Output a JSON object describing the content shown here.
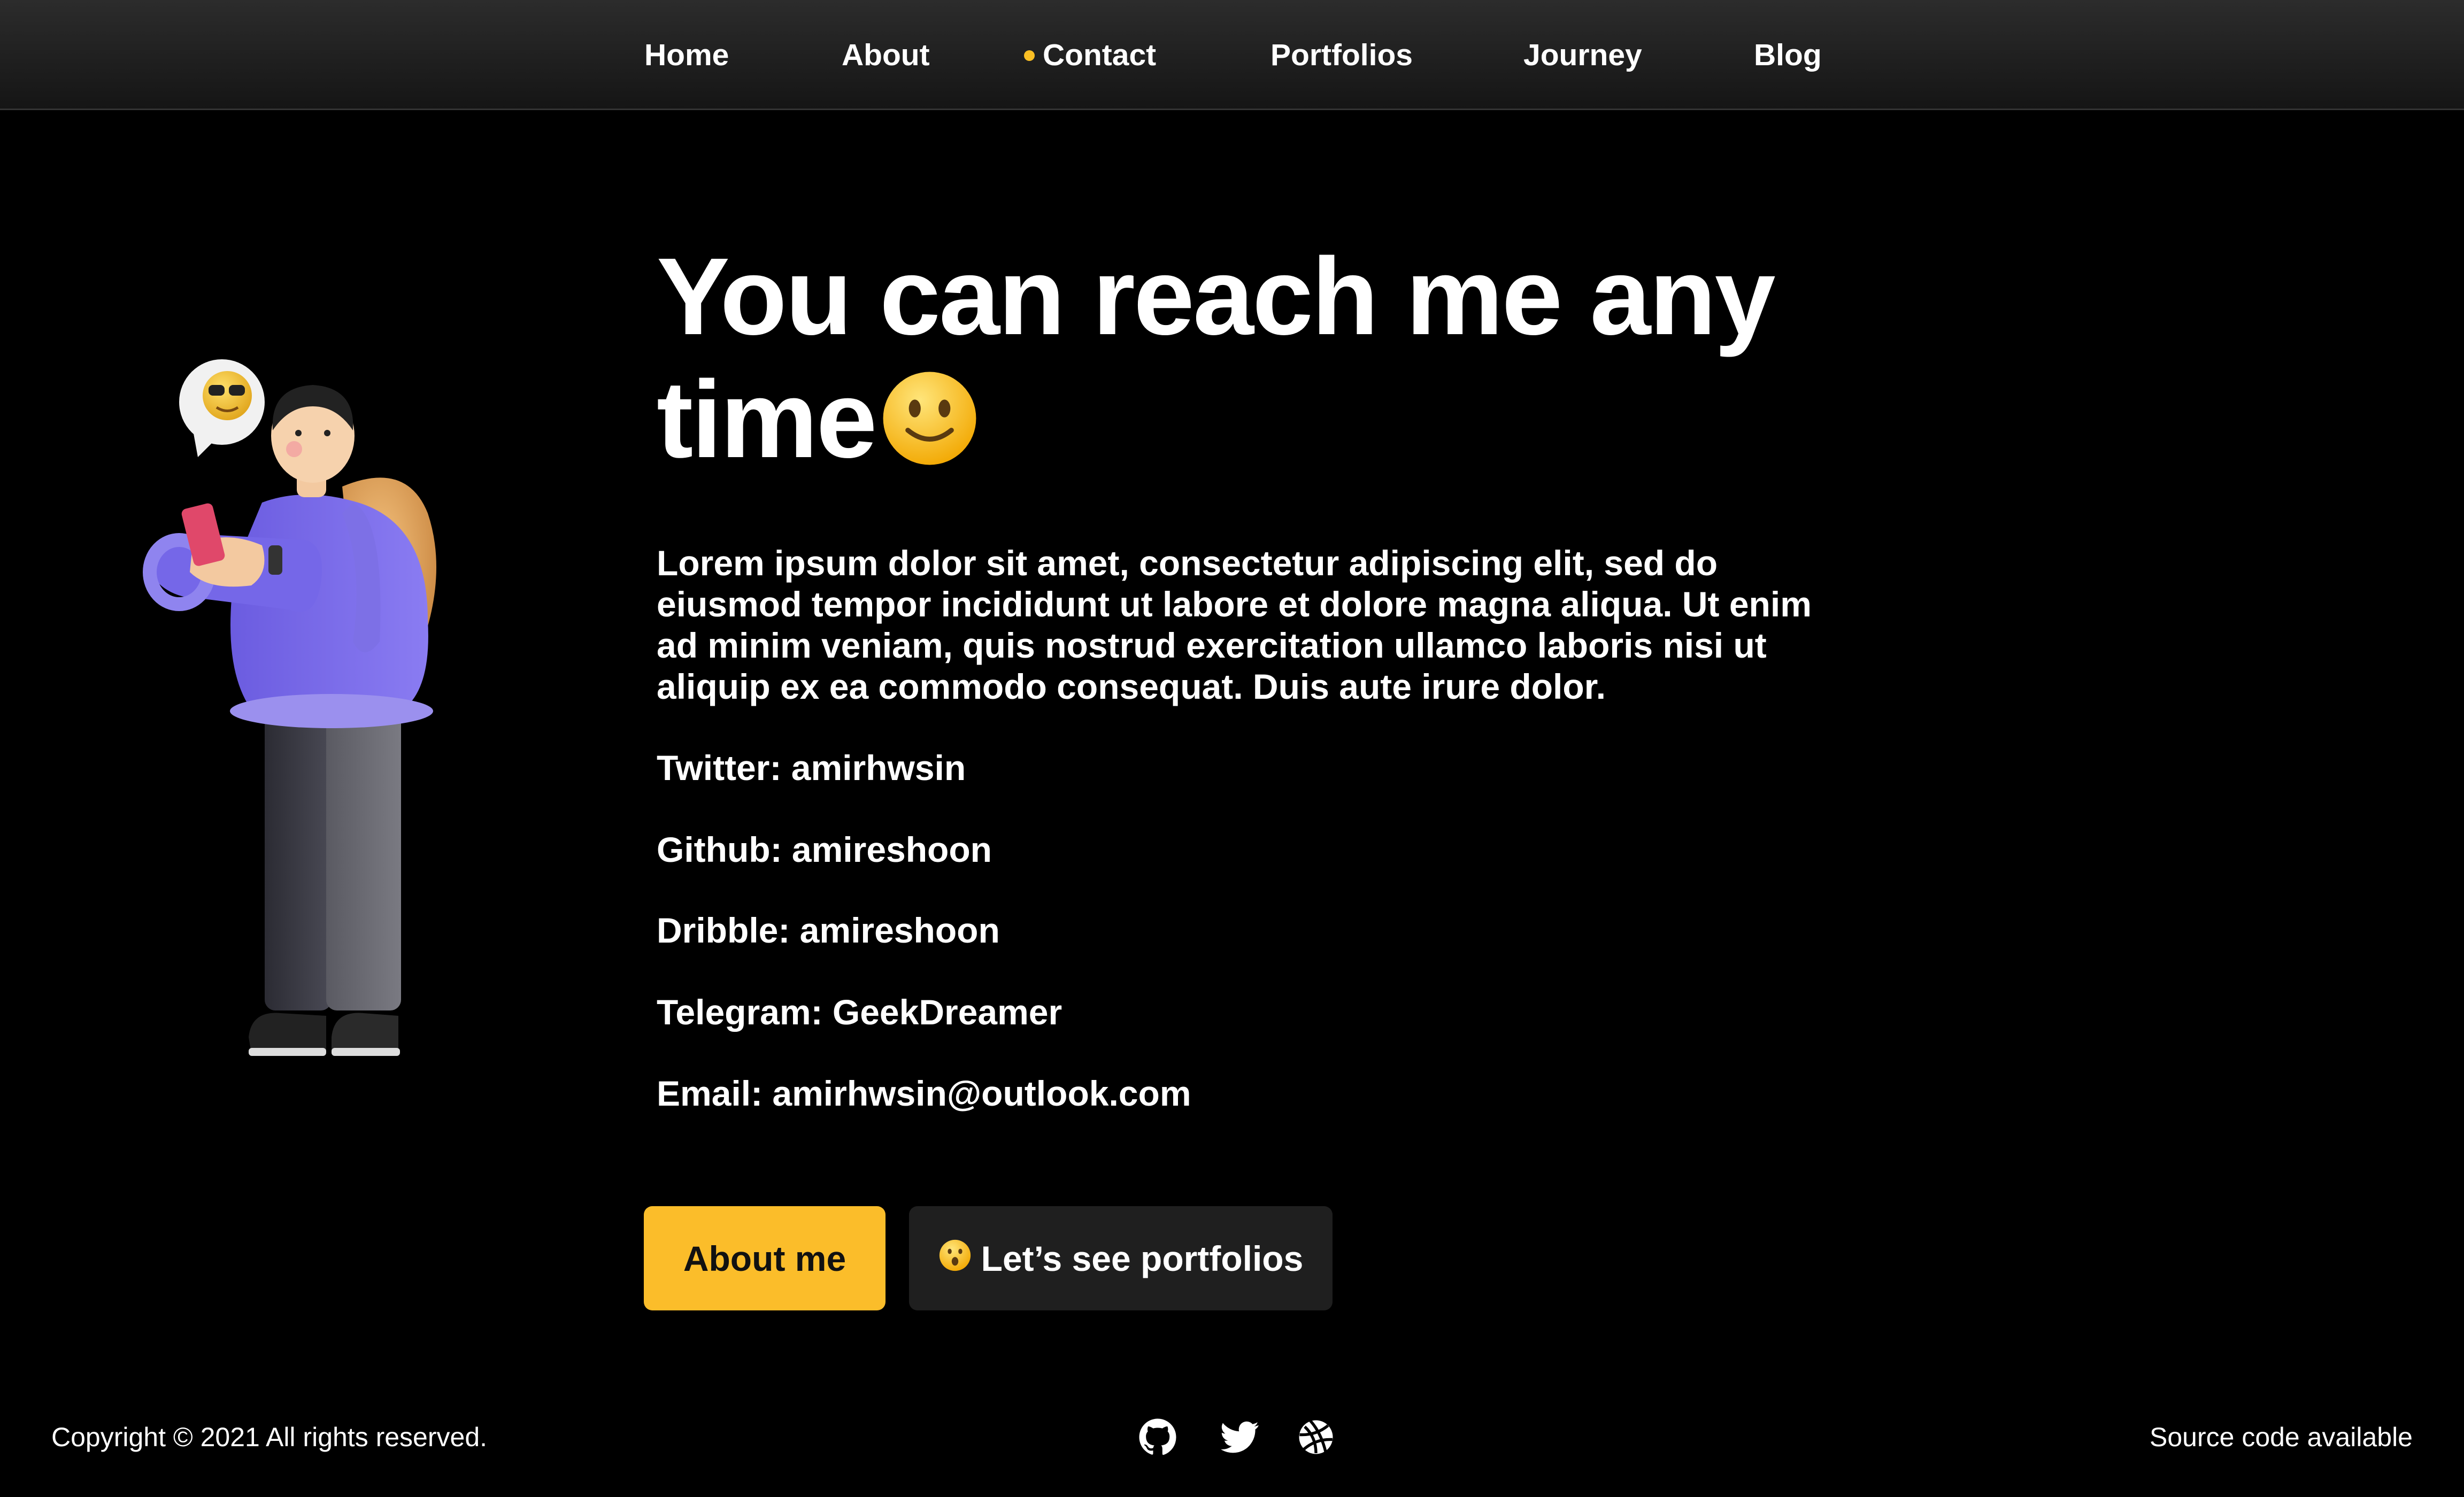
{
  "nav": {
    "items": [
      {
        "label": "Home"
      },
      {
        "label": "About"
      },
      {
        "label": "Contact",
        "active": true
      },
      {
        "label": "Portfolios"
      },
      {
        "label": "Journey"
      },
      {
        "label": "Blog"
      }
    ]
  },
  "hero": {
    "title_line1": "You can reach me any",
    "title_line2": "time",
    "title_emoji": "slightly-smiling-face-icon",
    "intro": "Lorem ipsum dolor sit amet, consectetur adipiscing elit, sed do eiusmod tempor incididunt ut labore et dolore magna aliqua. Ut enim ad minim veniam, quis nostrud exercitation ullamco laboris nisi ut aliquip ex ea commodo consequat. Duis aute irure dolor.",
    "contacts": {
      "twitter": "Twitter: amirhwsin",
      "github": "Github: amireshoon",
      "dribble": "Dribble: amireshoon",
      "telegram": "Telegram: GeekDreamer",
      "email": "Email: amirhwsin@outlook.com"
    }
  },
  "buttons": {
    "about_label": "About me",
    "portfolios_label": "Let’s see portfolios",
    "portfolios_emoji": "astonished-face-icon"
  },
  "footer": {
    "copyright": "Copyright © 2021 All rights reserved.",
    "source": "Source code available",
    "icons": [
      "github-icon",
      "twitter-icon",
      "dribbble-icon"
    ]
  },
  "colors": {
    "accent": "#fbbd2a",
    "background": "#000000",
    "secondary_button": "#1f1f1f"
  }
}
